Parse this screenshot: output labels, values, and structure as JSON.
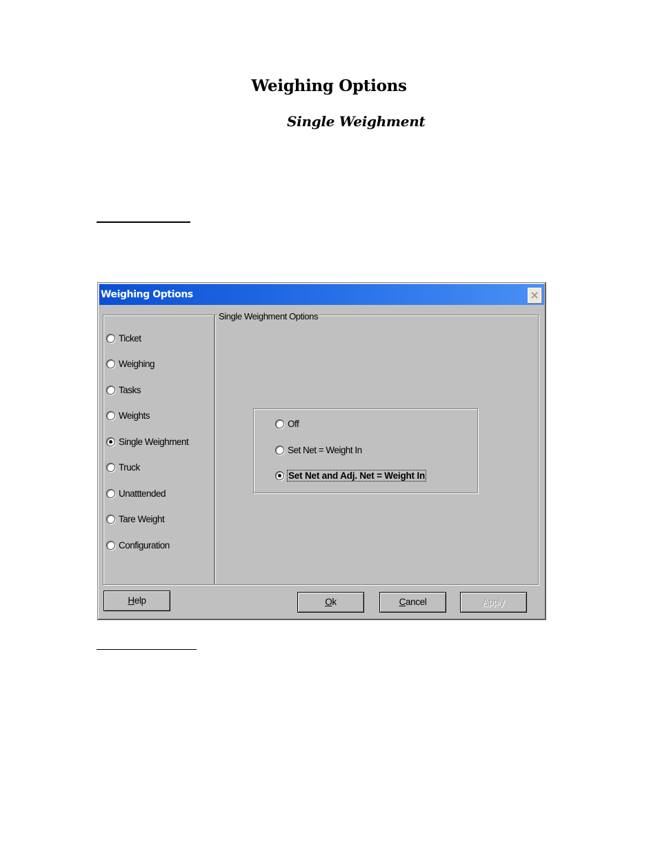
{
  "document": {
    "title": "Weighing Options",
    "subtitle": "Single Weighment"
  },
  "dialog": {
    "title": "Weighing Options",
    "close_icon": "close-icon",
    "sidebar": {
      "items": [
        {
          "label": "Ticket",
          "selected": false
        },
        {
          "label": "Weighing",
          "selected": false
        },
        {
          "label": "Tasks",
          "selected": false
        },
        {
          "label": "Weights",
          "selected": false
        },
        {
          "label": "Single Weighment",
          "selected": true
        },
        {
          "label": "Truck",
          "selected": false
        },
        {
          "label": "Unatttended",
          "selected": false
        },
        {
          "label": "Tare Weight",
          "selected": false
        },
        {
          "label": "Configuration",
          "selected": false
        }
      ]
    },
    "group": {
      "label": "Single Weighment Options",
      "options": [
        {
          "label": "Off",
          "selected": false
        },
        {
          "label": "Set Net = Weight In",
          "selected": false
        },
        {
          "label": "Set Net and Adj. Net = Weight In",
          "selected": true
        }
      ]
    },
    "buttons": {
      "help": {
        "mnemonic": "H",
        "rest": "elp"
      },
      "ok": {
        "mnemonic": "O",
        "rest": "k"
      },
      "cancel": {
        "mnemonic": "C",
        "rest": "ancel"
      },
      "apply": {
        "mnemonic": "A",
        "rest": "pply",
        "disabled": true
      }
    }
  }
}
